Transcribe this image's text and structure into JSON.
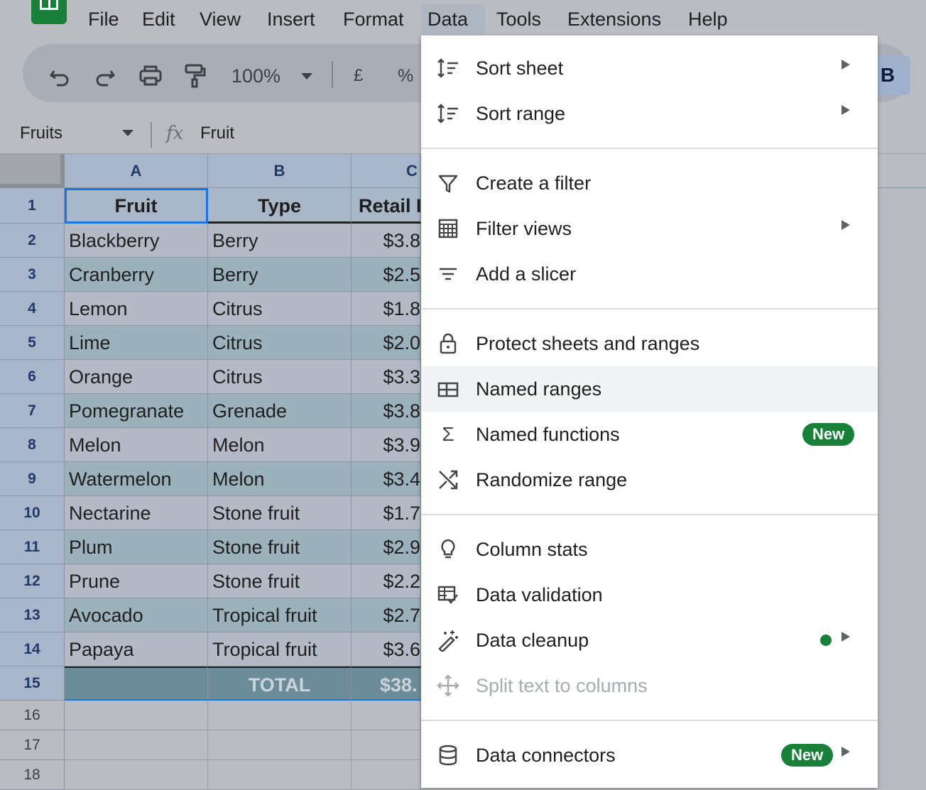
{
  "menubar": {
    "items": [
      "File",
      "Edit",
      "View",
      "Insert",
      "Format",
      "Data",
      "Tools",
      "Extensions",
      "Help"
    ],
    "active": "Data"
  },
  "toolbar": {
    "zoom": "100%",
    "currency": "£",
    "percent": "%",
    "bold": "B",
    "icons": [
      "undo-icon",
      "redo-icon",
      "print-icon",
      "paint-format-icon",
      "chevron-down-icon"
    ]
  },
  "formula_bar": {
    "name_box": "Fruits",
    "fx": "fx",
    "content": "Fruit"
  },
  "sheet": {
    "columns": [
      "A",
      "B",
      "C"
    ],
    "rows": [
      {
        "n": "1",
        "a": "Fruit",
        "b": "Type",
        "c": "Retail I"
      },
      {
        "n": "2",
        "a": "Blackberry",
        "b": "Berry",
        "c": "$3.8"
      },
      {
        "n": "3",
        "a": "Cranberry",
        "b": "Berry",
        "c": "$2.5"
      },
      {
        "n": "4",
        "a": "Lemon",
        "b": "Citrus",
        "c": "$1.8"
      },
      {
        "n": "5",
        "a": "Lime",
        "b": "Citrus",
        "c": "$2.0"
      },
      {
        "n": "6",
        "a": "Orange",
        "b": "Citrus",
        "c": "$3.3"
      },
      {
        "n": "7",
        "a": "Pomegranate",
        "b": "Grenade",
        "c": "$3.8"
      },
      {
        "n": "8",
        "a": "Melon",
        "b": "Melon",
        "c": "$3.9"
      },
      {
        "n": "9",
        "a": "Watermelon",
        "b": "Melon",
        "c": "$3.4"
      },
      {
        "n": "10",
        "a": "Nectarine",
        "b": "Stone fruit",
        "c": "$1.7"
      },
      {
        "n": "11",
        "a": "Plum",
        "b": "Stone fruit",
        "c": "$2.9"
      },
      {
        "n": "12",
        "a": "Prune",
        "b": "Stone fruit",
        "c": "$2.2"
      },
      {
        "n": "13",
        "a": "Avocado",
        "b": "Tropical fruit",
        "c": "$2.7"
      },
      {
        "n": "14",
        "a": "Papaya",
        "b": "Tropical fruit",
        "c": "$3.6"
      },
      {
        "n": "15",
        "a": "",
        "b": "TOTAL",
        "c": "$38."
      }
    ],
    "empty_rows": [
      "16",
      "17",
      "18"
    ]
  },
  "data_menu": {
    "items": [
      {
        "label": "Sort sheet",
        "icon": "sort-icon",
        "submenu": true
      },
      {
        "label": "Sort range",
        "icon": "sort-icon",
        "submenu": true
      },
      {
        "label": "Create a filter",
        "icon": "filter-icon"
      },
      {
        "label": "Filter views",
        "icon": "filter-views-icon",
        "submenu": true
      },
      {
        "label": "Add a slicer",
        "icon": "slicer-icon"
      },
      {
        "label": "Protect sheets and ranges",
        "icon": "lock-icon"
      },
      {
        "label": "Named ranges",
        "icon": "named-ranges-icon",
        "highlighted": true
      },
      {
        "label": "Named functions",
        "icon": "sigma-icon",
        "badge": "New"
      },
      {
        "label": "Randomize range",
        "icon": "shuffle-icon"
      },
      {
        "label": "Column stats",
        "icon": "lightbulb-icon"
      },
      {
        "label": "Data validation",
        "icon": "data-validation-icon"
      },
      {
        "label": "Data cleanup",
        "icon": "magic-wand-icon",
        "submenu": true,
        "dot": true
      },
      {
        "label": "Split text to columns",
        "icon": "split-icon",
        "disabled": true
      },
      {
        "label": "Data connectors",
        "icon": "database-icon",
        "submenu": true,
        "badge": "New"
      }
    ]
  },
  "colors": {
    "accent_green": "#188038",
    "highlight": "#f1f3f4",
    "selection_blue": "#1a73e8"
  }
}
